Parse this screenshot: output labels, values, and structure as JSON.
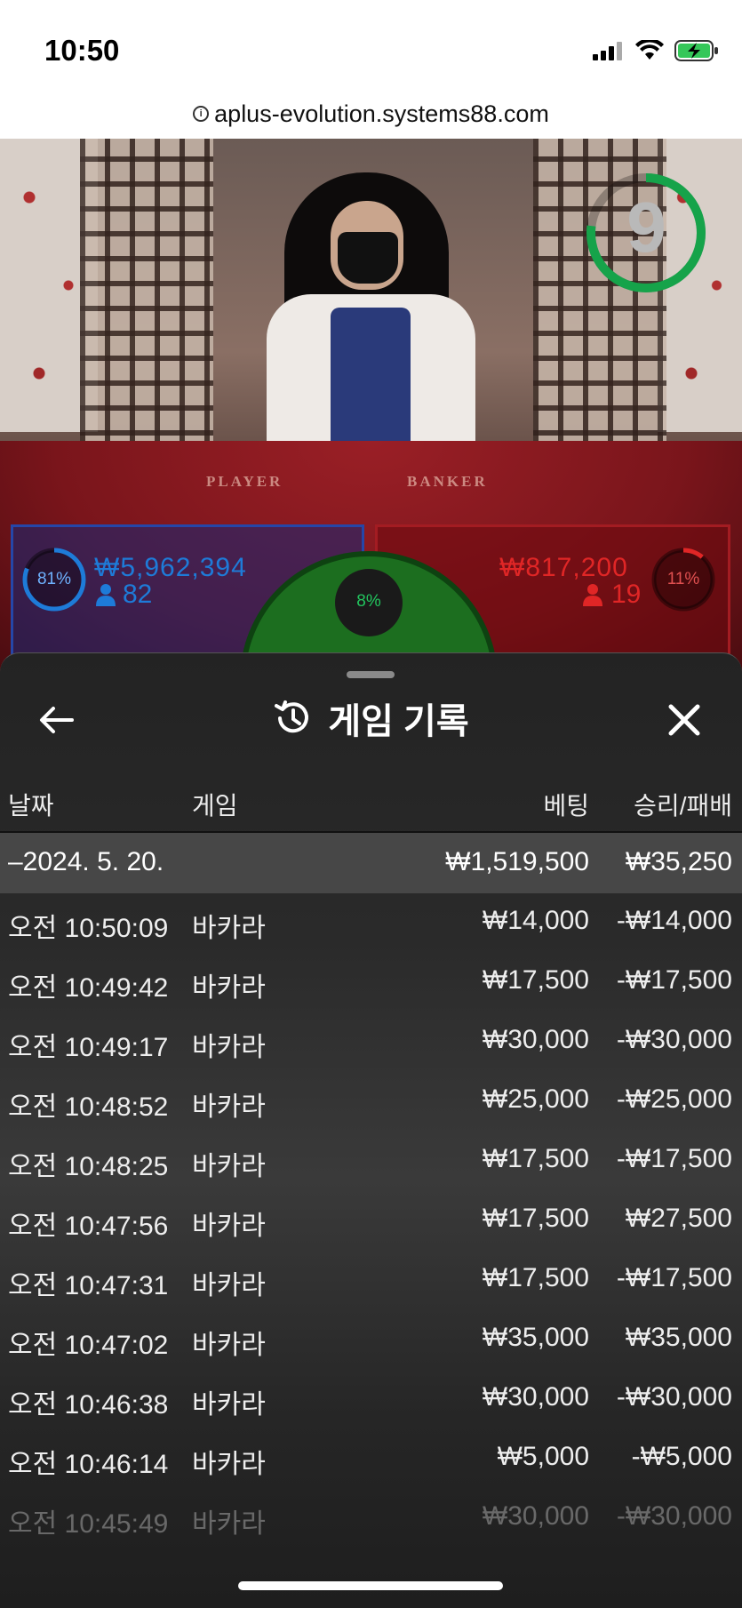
{
  "status_bar": {
    "time": "10:50"
  },
  "browser": {
    "url": "aplus-evolution.systems88.com"
  },
  "video": {
    "table_labels": {
      "player": "PLAYER",
      "banker": "BANKER"
    },
    "timer_value": "9",
    "timer_color": "#16a34a"
  },
  "betting": {
    "player": {
      "percent": "81%",
      "amount": "₩5,962,394",
      "count": "82",
      "color": "#1e7bd8"
    },
    "banker": {
      "percent": "11%",
      "amount": "₩817,200",
      "count": "19",
      "color": "#e02626"
    },
    "tie": {
      "percent": "8%",
      "color": "#22c55e"
    }
  },
  "sheet": {
    "title": "게임 기록",
    "columns": {
      "date": "날짜",
      "game": "게임",
      "bet": "베팅",
      "win_loss": "승리/패배"
    },
    "date_group": {
      "label": "–2024. 5. 20.",
      "bet_total": "₩1,519,500",
      "win_loss_total": "₩35,250"
    },
    "rows": [
      {
        "time": "오전 10:50:09",
        "game": "바카라",
        "bet": "₩14,000",
        "win_loss": "-₩14,000"
      },
      {
        "time": "오전 10:49:42",
        "game": "바카라",
        "bet": "₩17,500",
        "win_loss": "-₩17,500"
      },
      {
        "time": "오전 10:49:17",
        "game": "바카라",
        "bet": "₩30,000",
        "win_loss": "-₩30,000"
      },
      {
        "time": "오전 10:48:52",
        "game": "바카라",
        "bet": "₩25,000",
        "win_loss": "-₩25,000"
      },
      {
        "time": "오전 10:48:25",
        "game": "바카라",
        "bet": "₩17,500",
        "win_loss": "-₩17,500"
      },
      {
        "time": "오전 10:47:56",
        "game": "바카라",
        "bet": "₩17,500",
        "win_loss": "₩27,500"
      },
      {
        "time": "오전 10:47:31",
        "game": "바카라",
        "bet": "₩17,500",
        "win_loss": "-₩17,500"
      },
      {
        "time": "오전 10:47:02",
        "game": "바카라",
        "bet": "₩35,000",
        "win_loss": "₩35,000"
      },
      {
        "time": "오전 10:46:38",
        "game": "바카라",
        "bet": "₩30,000",
        "win_loss": "-₩30,000"
      },
      {
        "time": "오전 10:46:14",
        "game": "바카라",
        "bet": "₩5,000",
        "win_loss": "-₩5,000"
      },
      {
        "time": "오전 10:45:49",
        "game": "바카라",
        "bet": "₩30,000",
        "win_loss": "-₩30,000"
      }
    ],
    "icons": {
      "back": "arrow-left-icon",
      "history": "history-icon",
      "close": "close-icon"
    }
  }
}
